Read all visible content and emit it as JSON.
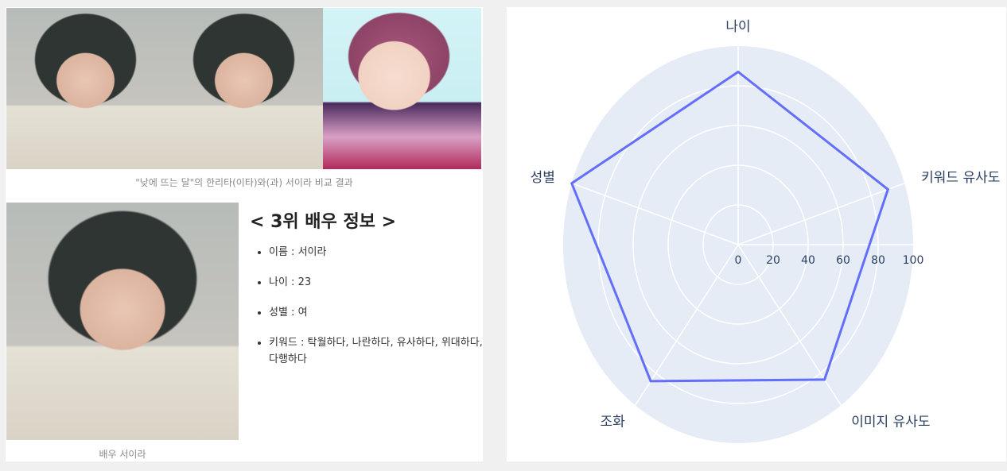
{
  "comparison": {
    "images": [
      {
        "kind": "actor-photo",
        "alt": "서이라"
      },
      {
        "kind": "actor-photo",
        "alt": "서이라"
      },
      {
        "kind": "webtoon-character",
        "alt": "한리타(이타)"
      }
    ],
    "caption": "\"낮에 뜨는 달\"의 한리타(이타)와(과) 서이라 비교 결과"
  },
  "actor": {
    "caption": "배우 서이라",
    "heading": "< 3위 배우 정보 >",
    "info": [
      "이름 : 서이라",
      "나이 : 23",
      "성별 : 여",
      "키워드 : 탁월하다, 나란하다, 유사하다, 위대하다, 다행하다"
    ]
  },
  "chart_data": {
    "type": "radar",
    "categories": [
      "나이",
      "키워드 유사도",
      "이미지 유사도",
      "조화",
      "성별"
    ],
    "values": [
      87,
      90,
      84,
      85,
      100
    ],
    "radial_range": [
      0,
      100
    ],
    "radial_ticks": [
      "0",
      "20",
      "40",
      "60",
      "80",
      "100"
    ],
    "line_color": "#636efa",
    "background_color": "#e5ecf6",
    "grid": true
  }
}
